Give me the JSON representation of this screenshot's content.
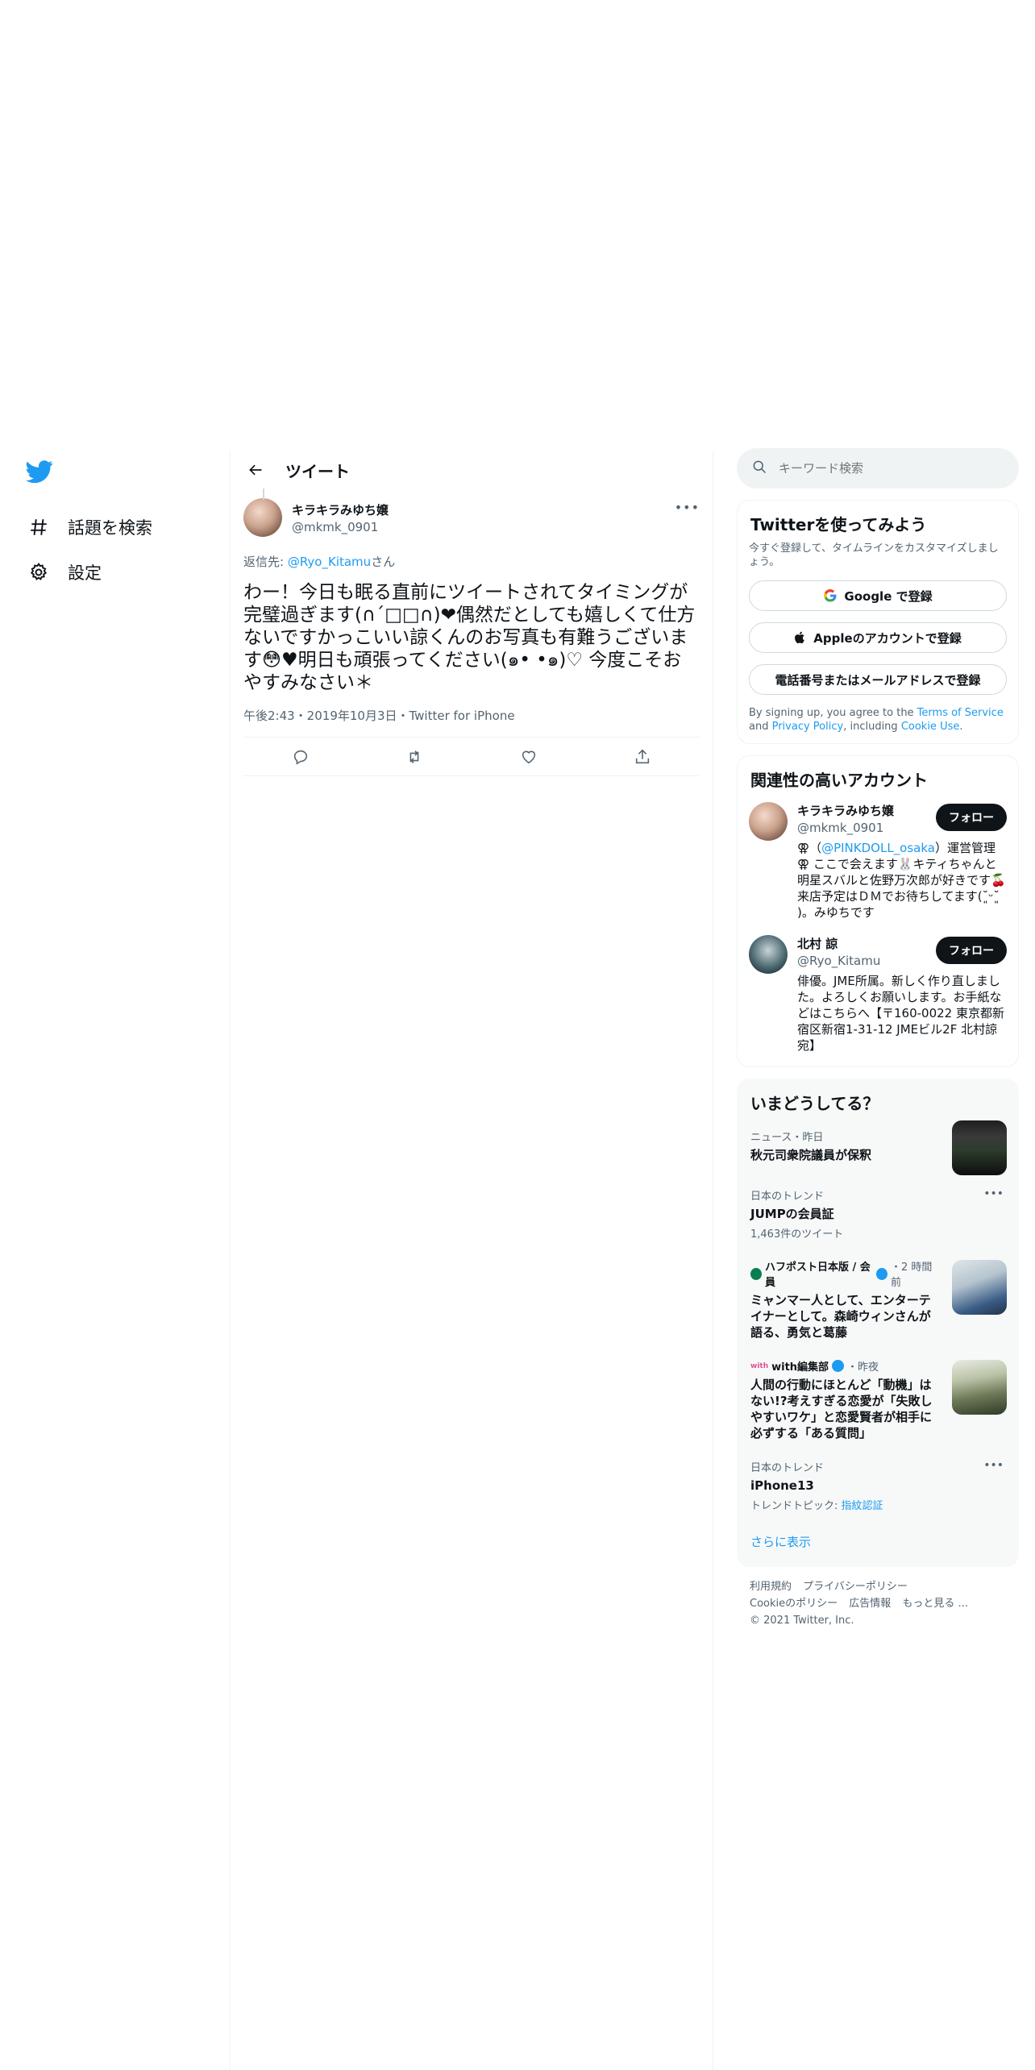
{
  "nav": {
    "items": [
      {
        "label": "話題を検索",
        "icon": "hashtag-icon"
      },
      {
        "label": "設定",
        "icon": "gear-icon"
      }
    ]
  },
  "main": {
    "header_title": "ツイート",
    "tweet": {
      "display_name": "キラキラみゆち嬢",
      "username": "@mkmk_0901",
      "reply_prefix": "返信先: ",
      "reply_user": "@Ryo_Kitamu",
      "reply_suffix": "さん",
      "text": "わー！今日も眠る直前にツイートされてタイミングが完璧過ぎます(∩´□□∩)❤偶然だとしても嬉しくて仕方ないですかっこいい諒くんのお写真も有難うございます😳♥明日も頑張ってください(๑• •๑)♡ 今度こそおやすみなさい＊",
      "meta": "午後2:43・2019年10月3日・Twitter for iPhone"
    }
  },
  "right": {
    "search_placeholder": "キーワード検索",
    "signup": {
      "title": "Twitterを使ってみよう",
      "subtitle": "今すぐ登録して、タイムラインをカスタマイズしましょう。",
      "google": "Google で登録",
      "apple": "Appleのアカウントで登録",
      "phone": "電話番号またはメールアドレスで登録",
      "legal_1": "By signing up, you agree to the ",
      "tos": "Terms of Service",
      "legal_2": " and ",
      "privacy": "Privacy Policy",
      "legal_3": ", including ",
      "cookie": "Cookie Use",
      "legal_4": "."
    },
    "related": {
      "title": "関連性の高いアカウント",
      "follow_label": "フォロー",
      "accounts": [
        {
          "display_name": "キラキラみゆち嬢",
          "username": "@mkmk_0901",
          "bio_pre": "⚢（",
          "bio_link": "@PINKDOLL_osaka",
          "bio_post": "）運営管理 ⚢ ここで会えます🐰キティちゃんと明星スバルと佐野万次郎が好きです🍒来店予定はＤＭでお待ちしてます(˘͈ᵕ˘͈ )。みゆちです"
        },
        {
          "display_name": "北村 諒",
          "username": "@Ryo_Kitamu",
          "bio": "俳優。JME所属。新しく作り直しました。よろしくお願いします。お手紙などはこちらへ【〒160-0022 東京都新宿区新宿1-31-12 JMEビル2F 北村諒宛】"
        }
      ]
    },
    "trends": {
      "title": "いまどうしてる？",
      "items": [
        {
          "context": "ニュース・昨日",
          "title": "秋元司衆院議員が保釈"
        },
        {
          "context": "日本のトレンド",
          "title": "JUMPの会員証",
          "count": "1,463件のツイート"
        },
        {
          "publisher": "ハフポスト日本版 / 会員",
          "time": "・2 時間前",
          "title": "ミャンマー人として、エンターテイナーとして。森崎ウィンさんが語る、勇気と葛藤"
        },
        {
          "publisher": "with編集部",
          "time": "・昨夜",
          "title": "人間の行動にほとんど「動機」はない!?考えすぎる恋愛が「失敗しやすいワケ」と恋愛賢者が相手に必ずする「ある質問」"
        },
        {
          "context": "日本のトレンド",
          "title": "iPhone13",
          "topic_prefix": "トレンドトピック: ",
          "topic_link": "指紋認証"
        }
      ],
      "show_more": "さらに表示"
    },
    "footer": {
      "links": [
        "利用規約",
        "プライバシーポリシー",
        "Cookieのポリシー",
        "広告情報",
        "もっと見る ..."
      ],
      "copyright": "© 2021 Twitter, Inc."
    }
  },
  "colors": {
    "accent": "#1d9bf0",
    "text": "#0f1419",
    "muted": "#536471",
    "border": "#eff3f4"
  }
}
